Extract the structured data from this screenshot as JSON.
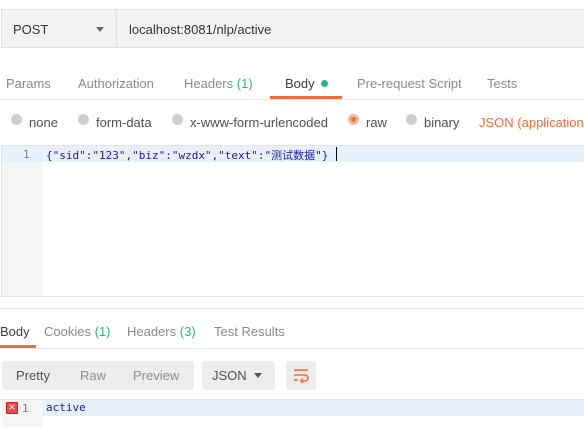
{
  "request": {
    "method": "POST",
    "url": "localhost:8081/nlp/active"
  },
  "request_tabs": [
    {
      "label": "Params",
      "count": ""
    },
    {
      "label": "Authorization",
      "count": ""
    },
    {
      "label": "Headers",
      "count": "(1)"
    },
    {
      "label": "Body",
      "count": ""
    },
    {
      "label": "Pre-request Script",
      "count": ""
    },
    {
      "label": "Tests",
      "count": ""
    }
  ],
  "active_request_tab": "Body",
  "body_types": {
    "none": "none",
    "form_data": "form-data",
    "urlencoded": "x-www-form-urlencoded",
    "raw": "raw",
    "binary": "binary",
    "selected": "raw",
    "content_type": "JSON (application/j"
  },
  "editor": {
    "line_number": "1",
    "code": "{\"sid\":\"123\",\"biz\":\"wzdx\",\"text\":\"测试数据\"}"
  },
  "response_tabs": [
    {
      "label": "Body",
      "count": ""
    },
    {
      "label": "Cookies",
      "count": "(1)"
    },
    {
      "label": "Headers",
      "count": "(3)"
    },
    {
      "label": "Test Results",
      "count": ""
    }
  ],
  "active_response_tab": "Body",
  "view_modes": [
    "Pretty",
    "Raw",
    "Preview"
  ],
  "active_view_mode": "Pretty",
  "language": "JSON",
  "response": {
    "line_number": "1",
    "code": "active",
    "has_error_marker": true
  },
  "colors": {
    "accent": "#f26b3a",
    "count_green": "#26b47f"
  },
  "icons": [
    "chevron-down-icon",
    "wrap-lines-icon",
    "error-marker-icon"
  ]
}
